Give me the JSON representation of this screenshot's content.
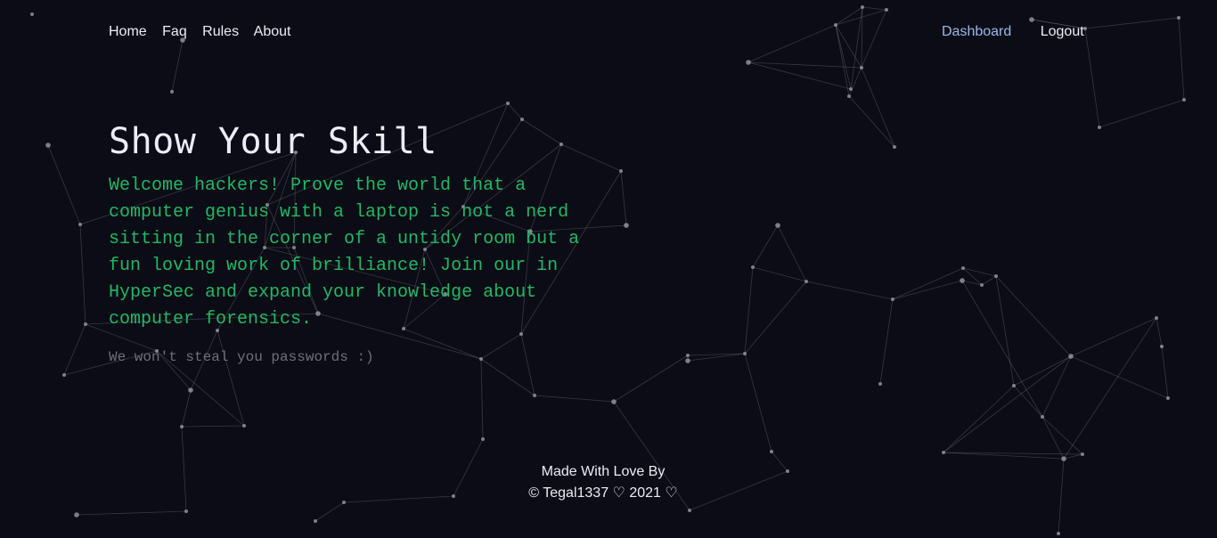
{
  "nav": {
    "left": [
      "Home",
      "Faq",
      "Rules",
      "About"
    ],
    "dashboard": "Dashboard",
    "logout": "Logout"
  },
  "hero": {
    "title": "Show Your Skill",
    "welcome": "Welcome hackers! Prove the world that a computer genius with a laptop is not a nerd sitting in the corner of a untidy room but a fun loving work of brilliance! Join our in HyperSec and expand your knowledge about computer forensics.",
    "note": "We won't steal you passwords :)"
  },
  "footer": {
    "line1": "Made With Love By",
    "line2": "© Tegal1337 ♡ 2021 ♡"
  },
  "colors": {
    "background": "#0c0c16",
    "accent_green": "#22b864",
    "link_blue": "#9bb8e6"
  }
}
